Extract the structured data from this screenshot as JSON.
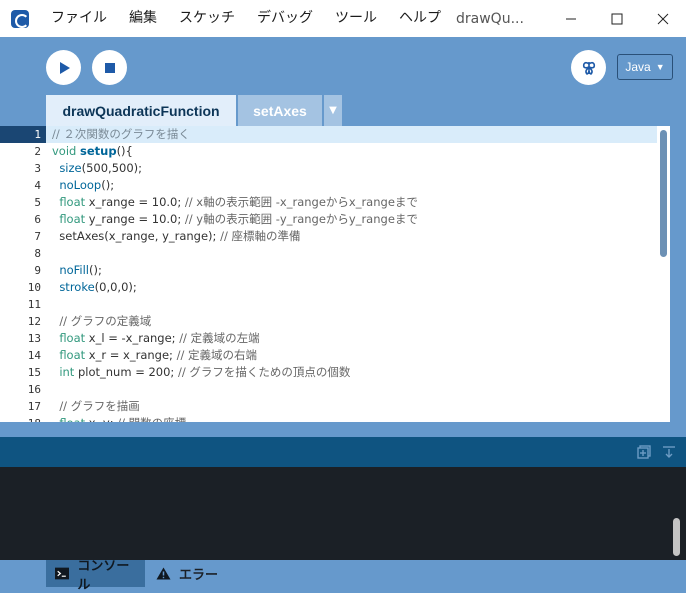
{
  "menu": {
    "items": [
      "ファイル",
      "編集",
      "スケッチ",
      "デバッグ",
      "ツール",
      "ヘルプ"
    ],
    "window_title": "drawQu..."
  },
  "toolbar": {
    "mode_label": "Java"
  },
  "tabs": [
    {
      "label": "drawQuadraticFunction",
      "active": true
    },
    {
      "label": "setAxes",
      "active": false
    }
  ],
  "editor": {
    "current_line": 1,
    "lines": [
      {
        "n": "1",
        "text": "// ２次関数のグラフを描く"
      },
      {
        "n": "2",
        "text": "void setup(){"
      },
      {
        "n": "3",
        "text": "  size(500,500);"
      },
      {
        "n": "4",
        "text": "  noLoop();"
      },
      {
        "n": "5",
        "text": "  float x_range = 10.0; // x軸の表示範囲 -x_rangeからx_rangeまで"
      },
      {
        "n": "6",
        "text": "  float y_range = 10.0; // y軸の表示範囲 -y_rangeからy_rangeまで"
      },
      {
        "n": "7",
        "text": "  setAxes(x_range, y_range); // 座標軸の準備"
      },
      {
        "n": "8",
        "text": ""
      },
      {
        "n": "9",
        "text": "  noFill();"
      },
      {
        "n": "10",
        "text": "  stroke(0,0,0);"
      },
      {
        "n": "11",
        "text": ""
      },
      {
        "n": "12",
        "text": "  // グラフの定義域"
      },
      {
        "n": "13",
        "text": "  float x_l = -x_range; // 定義域の左端"
      },
      {
        "n": "14",
        "text": "  float x_r = x_range; // 定義域の右端"
      },
      {
        "n": "15",
        "text": "  int plot_num = 200; // グラフを描くための頂点の個数"
      },
      {
        "n": "16",
        "text": ""
      },
      {
        "n": "17",
        "text": "  // グラフを描画"
      },
      {
        "n": "18",
        "text": "  float x, y; // 関数の座標"
      }
    ]
  },
  "footer": {
    "console_label": "コンソール",
    "error_label": "エラー"
  },
  "colors": {
    "toolbar_bg": "#6699cc",
    "console_header": "#0f5481",
    "console_bg": "#1b2026",
    "current_line": "#d9ecfa",
    "accent": "#1e5aa8"
  }
}
